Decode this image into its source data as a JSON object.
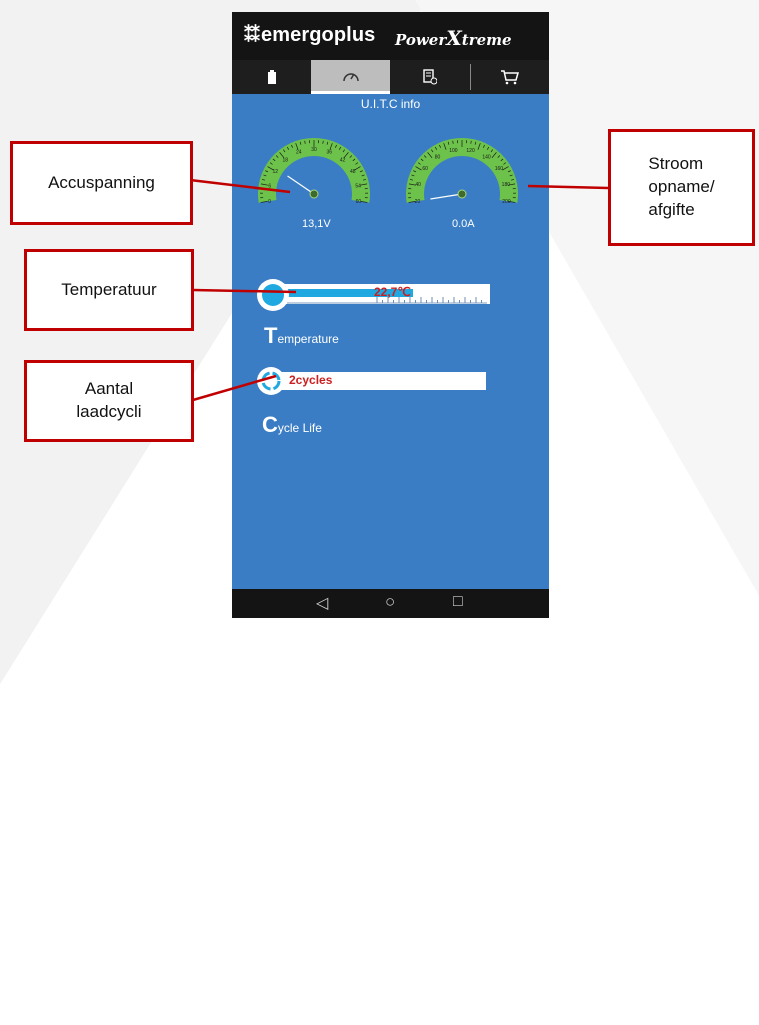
{
  "app": {
    "brand": "emergoplus",
    "brand_dots": "⁑⁑",
    "product_a": "Power",
    "product_b": "X",
    "product_c": "treme"
  },
  "tabs": [
    {
      "icon": "battery-icon",
      "glyph": "▮"
    },
    {
      "icon": "gauge-icon",
      "glyph": "⊙"
    },
    {
      "icon": "document-info-icon",
      "glyph": "▤"
    },
    {
      "icon": "cart-icon",
      "glyph": "⛍"
    }
  ],
  "page": {
    "label": "U.I.T.C info"
  },
  "gauges": [
    {
      "name": "voltage",
      "value_label": "13,1V",
      "ticks": [
        "0",
        "6",
        "12",
        "18",
        "24",
        "30",
        "36",
        "42",
        "48",
        "54",
        "60"
      ],
      "value": 13.1,
      "max": 60
    },
    {
      "name": "current",
      "value_label": "0.0A",
      "ticks": [
        "20",
        "40",
        "60",
        "80",
        "100",
        "120",
        "140",
        "160",
        "180",
        "200"
      ],
      "value": 0,
      "max": 200
    }
  ],
  "temperature": {
    "value_label": "22,7℃",
    "title_cap": "T",
    "title_rest": "emperature",
    "fill_fraction": 0.63
  },
  "cycles": {
    "value_label": "2cycles",
    "title_cap": "C",
    "title_rest": "ycle Life"
  },
  "navbar": {
    "back": "◁",
    "home": "○",
    "recent": "□"
  },
  "callouts": {
    "voltage": "Accuspanning",
    "current_1": "Stroom",
    "current_2": "opname/",
    "current_3": "afgifte",
    "temperature": "Temperatuur",
    "cycles_1": "Aantal",
    "cycles_2": "laadcycli"
  },
  "colors": {
    "screen_bg": "#3a7dc4",
    "gauge_green": "#6cc24a",
    "bar_fill": "#1fa9e0",
    "value_red": "#cc1f1f",
    "callout_border": "#c00000"
  }
}
